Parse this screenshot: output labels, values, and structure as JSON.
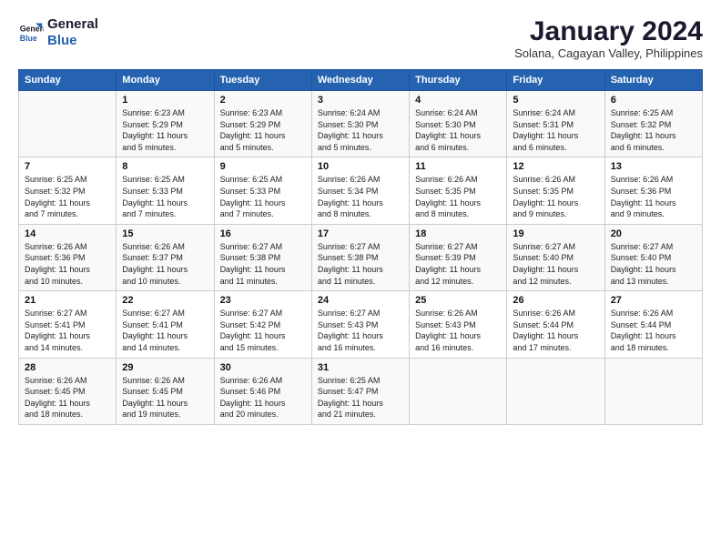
{
  "logo": {
    "line1": "General",
    "line2": "Blue"
  },
  "title": "January 2024",
  "subtitle": "Solana, Cagayan Valley, Philippines",
  "headers": [
    "Sunday",
    "Monday",
    "Tuesday",
    "Wednesday",
    "Thursday",
    "Friday",
    "Saturday"
  ],
  "weeks": [
    [
      {
        "day": "",
        "info": ""
      },
      {
        "day": "1",
        "info": "Sunrise: 6:23 AM\nSunset: 5:29 PM\nDaylight: 11 hours\nand 5 minutes."
      },
      {
        "day": "2",
        "info": "Sunrise: 6:23 AM\nSunset: 5:29 PM\nDaylight: 11 hours\nand 5 minutes."
      },
      {
        "day": "3",
        "info": "Sunrise: 6:24 AM\nSunset: 5:30 PM\nDaylight: 11 hours\nand 5 minutes."
      },
      {
        "day": "4",
        "info": "Sunrise: 6:24 AM\nSunset: 5:30 PM\nDaylight: 11 hours\nand 6 minutes."
      },
      {
        "day": "5",
        "info": "Sunrise: 6:24 AM\nSunset: 5:31 PM\nDaylight: 11 hours\nand 6 minutes."
      },
      {
        "day": "6",
        "info": "Sunrise: 6:25 AM\nSunset: 5:32 PM\nDaylight: 11 hours\nand 6 minutes."
      }
    ],
    [
      {
        "day": "7",
        "info": "Sunrise: 6:25 AM\nSunset: 5:32 PM\nDaylight: 11 hours\nand 7 minutes."
      },
      {
        "day": "8",
        "info": "Sunrise: 6:25 AM\nSunset: 5:33 PM\nDaylight: 11 hours\nand 7 minutes."
      },
      {
        "day": "9",
        "info": "Sunrise: 6:25 AM\nSunset: 5:33 PM\nDaylight: 11 hours\nand 7 minutes."
      },
      {
        "day": "10",
        "info": "Sunrise: 6:26 AM\nSunset: 5:34 PM\nDaylight: 11 hours\nand 8 minutes."
      },
      {
        "day": "11",
        "info": "Sunrise: 6:26 AM\nSunset: 5:35 PM\nDaylight: 11 hours\nand 8 minutes."
      },
      {
        "day": "12",
        "info": "Sunrise: 6:26 AM\nSunset: 5:35 PM\nDaylight: 11 hours\nand 9 minutes."
      },
      {
        "day": "13",
        "info": "Sunrise: 6:26 AM\nSunset: 5:36 PM\nDaylight: 11 hours\nand 9 minutes."
      }
    ],
    [
      {
        "day": "14",
        "info": "Sunrise: 6:26 AM\nSunset: 5:36 PM\nDaylight: 11 hours\nand 10 minutes."
      },
      {
        "day": "15",
        "info": "Sunrise: 6:26 AM\nSunset: 5:37 PM\nDaylight: 11 hours\nand 10 minutes."
      },
      {
        "day": "16",
        "info": "Sunrise: 6:27 AM\nSunset: 5:38 PM\nDaylight: 11 hours\nand 11 minutes."
      },
      {
        "day": "17",
        "info": "Sunrise: 6:27 AM\nSunset: 5:38 PM\nDaylight: 11 hours\nand 11 minutes."
      },
      {
        "day": "18",
        "info": "Sunrise: 6:27 AM\nSunset: 5:39 PM\nDaylight: 11 hours\nand 12 minutes."
      },
      {
        "day": "19",
        "info": "Sunrise: 6:27 AM\nSunset: 5:40 PM\nDaylight: 11 hours\nand 12 minutes."
      },
      {
        "day": "20",
        "info": "Sunrise: 6:27 AM\nSunset: 5:40 PM\nDaylight: 11 hours\nand 13 minutes."
      }
    ],
    [
      {
        "day": "21",
        "info": "Sunrise: 6:27 AM\nSunset: 5:41 PM\nDaylight: 11 hours\nand 14 minutes."
      },
      {
        "day": "22",
        "info": "Sunrise: 6:27 AM\nSunset: 5:41 PM\nDaylight: 11 hours\nand 14 minutes."
      },
      {
        "day": "23",
        "info": "Sunrise: 6:27 AM\nSunset: 5:42 PM\nDaylight: 11 hours\nand 15 minutes."
      },
      {
        "day": "24",
        "info": "Sunrise: 6:27 AM\nSunset: 5:43 PM\nDaylight: 11 hours\nand 16 minutes."
      },
      {
        "day": "25",
        "info": "Sunrise: 6:26 AM\nSunset: 5:43 PM\nDaylight: 11 hours\nand 16 minutes."
      },
      {
        "day": "26",
        "info": "Sunrise: 6:26 AM\nSunset: 5:44 PM\nDaylight: 11 hours\nand 17 minutes."
      },
      {
        "day": "27",
        "info": "Sunrise: 6:26 AM\nSunset: 5:44 PM\nDaylight: 11 hours\nand 18 minutes."
      }
    ],
    [
      {
        "day": "28",
        "info": "Sunrise: 6:26 AM\nSunset: 5:45 PM\nDaylight: 11 hours\nand 18 minutes."
      },
      {
        "day": "29",
        "info": "Sunrise: 6:26 AM\nSunset: 5:45 PM\nDaylight: 11 hours\nand 19 minutes."
      },
      {
        "day": "30",
        "info": "Sunrise: 6:26 AM\nSunset: 5:46 PM\nDaylight: 11 hours\nand 20 minutes."
      },
      {
        "day": "31",
        "info": "Sunrise: 6:25 AM\nSunset: 5:47 PM\nDaylight: 11 hours\nand 21 minutes."
      },
      {
        "day": "",
        "info": ""
      },
      {
        "day": "",
        "info": ""
      },
      {
        "day": "",
        "info": ""
      }
    ]
  ]
}
